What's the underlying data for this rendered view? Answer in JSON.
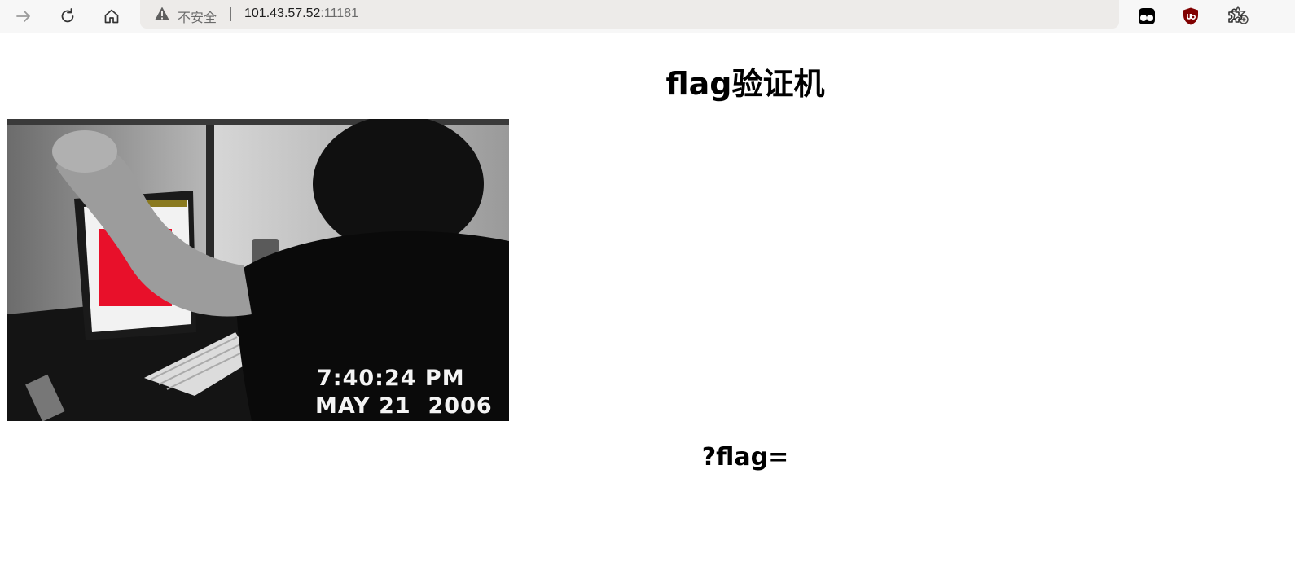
{
  "browser": {
    "security_label": "不安全",
    "url_host": "101.43.57.52",
    "url_port": ":11181",
    "nav_icons": [
      "forward-icon",
      "reload-icon",
      "home-icon"
    ],
    "extension_icons": [
      "tampermonkey-icon",
      "ublock-icon",
      "extensions-puzzle-icon"
    ]
  },
  "page": {
    "title": "flag验证机",
    "media": {
      "timestamp_time": "7:40:24 PM",
      "timestamp_date": "MAY 21  2006"
    },
    "query_hint": "?flag="
  }
}
